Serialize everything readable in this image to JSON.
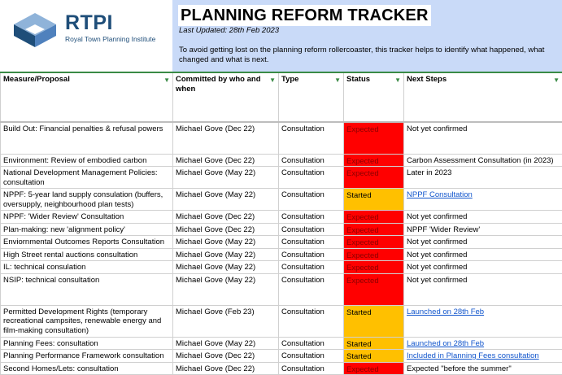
{
  "logo": {
    "name": "RTPI",
    "subtitle": "Royal Town Planning Institute"
  },
  "header": {
    "title": "PLANNING REFORM TRACKER",
    "updated": "Last Updated: 28th Feb 2023",
    "intro": "To avoid getting lost on the planning reform rollercoaster, this tracker helps to identify what happened, what changed and what is next."
  },
  "colors": {
    "expected": "#ff0000",
    "started": "#ffc000",
    "header_bg": "#c9daf8",
    "brand": "#1f4e79"
  },
  "columns": [
    "Measure/Proposal",
    "Committed by who and when",
    "Type",
    "Status",
    "Next Steps"
  ],
  "rows": [
    {
      "measure": "Build Out: Financial penalties & refusal powers",
      "by": "Michael Gove (Dec 22)",
      "type": "Consultation",
      "status": "Expected",
      "next": "Not yet confirmed",
      "link": false
    },
    {
      "measure": "Environment: Review of embodied carbon",
      "by": "Michael Gove (Dec 22)",
      "type": "Consultation",
      "status": "Expected",
      "next": "Carbon Assessment Consultation (in 2023)",
      "link": false
    },
    {
      "measure": "National Development Management Policies: consultation",
      "by": "Michael Gove (May 22)",
      "type": "Consultation",
      "status": "Expected",
      "next": "Later in 2023",
      "link": false
    },
    {
      "measure": "NPPF: 5-year land supply consulation (buffers, oversupply, neighbourhood plan tests)",
      "by": "Michael Gove (May 22)",
      "type": "Consultation",
      "status": "Started",
      "next": "NPPF Consultation",
      "link": true
    },
    {
      "measure": "NPPF: 'Wider Review' Consultation",
      "by": "Michael Gove (Dec 22)",
      "type": "Consultation",
      "status": "Expected",
      "next": "Not yet confirmed",
      "link": false
    },
    {
      "measure": "Plan-making: new 'alignment policy'",
      "by": "Michael Gove (Dec 22)",
      "type": "Consultation",
      "status": "Expected",
      "next": "NPPF 'Wider Review'",
      "link": false
    },
    {
      "measure": "Enviornmental Outcomes Reports Consultation",
      "by": "Michael Gove (May 22)",
      "type": "Consultation",
      "status": "Expected",
      "next": "Not yet confirmed",
      "link": false
    },
    {
      "measure": "High Street rental auctions consultation",
      "by": "Michael Gove (May 22)",
      "type": "Consultation",
      "status": "Expected",
      "next": "Not yet confirmed",
      "link": false
    },
    {
      "measure": "IL: technical consulation",
      "by": "Michael Gove (May 22)",
      "type": "Consultation",
      "status": "Expected",
      "next": "Not yet confirmed",
      "link": false
    },
    {
      "measure": "NSIP: technical consultation",
      "by": "Michael Gove (May 22)",
      "type": "Consultation",
      "status": "Expected",
      "next": "Not yet confirmed",
      "link": false
    },
    {
      "measure": "Permitted Development Rights (temporary recreational campsites, renewable energy and film-making consultation)",
      "by": "Michael Gove (Feb 23)",
      "type": "Consultation",
      "status": "Started",
      "next": "Launched on 28th Feb",
      "link": true
    },
    {
      "measure": "Planning Fees: consultation",
      "by": "Michael Gove (May 22)",
      "type": "Consultation",
      "status": "Started",
      "next": "Launched on 28th Feb",
      "link": true
    },
    {
      "measure": "Planning Performance Framework consultation",
      "by": "Michael Gove (Dec 22)",
      "type": "Consultation",
      "status": "Started",
      "next": "Included in Planning Fees consultation",
      "link": true
    },
    {
      "measure": "Second Homes/Lets: consultation",
      "by": "Michael Gove (Dec 22)",
      "type": "Consultation",
      "status": "Expected",
      "next": "Expected \"before the summer\"",
      "link": false
    }
  ]
}
